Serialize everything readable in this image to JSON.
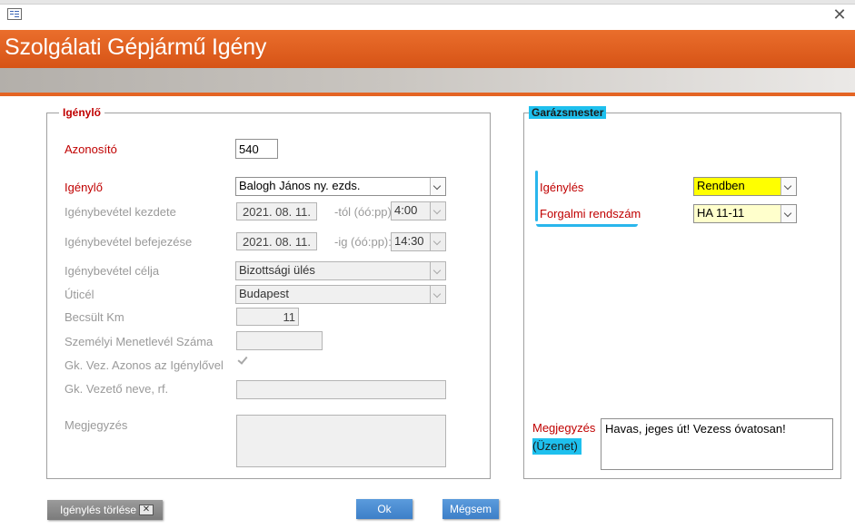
{
  "window": {
    "title": "Szolgálati Gépjármű Igény"
  },
  "igenylo_group": {
    "legend": "Igénylő",
    "azonosito": {
      "label": "Azonosító",
      "value": "540"
    },
    "igenylo": {
      "label": "Igénylő",
      "value": "Balogh János ny. ezds."
    },
    "kezdete": {
      "label": "Igénybevétel kezdete",
      "date": "2021. 08. 11.",
      "time_label": "-tól (óó:pp):",
      "time": "4:00"
    },
    "befejezese": {
      "label": "Igénybevétel befejezése",
      "date": "2021. 08. 11.",
      "time_label": "-ig (óó:pp):",
      "time": "14:30"
    },
    "celja": {
      "label": "Igénybevétel célja",
      "value": "Bizottsági ülés"
    },
    "uticel": {
      "label": "Úticél",
      "value": "Budapest"
    },
    "km": {
      "label": "Becsült Km",
      "value": "11"
    },
    "menetlevel": {
      "label": "Személyi Menetlevél Száma",
      "value": ""
    },
    "gk_azonos": {
      "label": "Gk. Vez. Azonos az Igénylővel",
      "checked": true
    },
    "gk_nev": {
      "label": "Gk. Vezető neve, rf.",
      "value": ""
    },
    "megjegyzes": {
      "label": "Megjegyzés",
      "value": ""
    }
  },
  "garazs_group": {
    "legend": "Garázsmester",
    "igenyles": {
      "label": "Igénylés",
      "value": "Rendben"
    },
    "rendszam": {
      "label": "Forgalmi rendszám",
      "value": "HA 11-11"
    },
    "megjegyzes": {
      "label": "Megjegyzés",
      "label2": "(Üzenet)",
      "value": "Havas, jeges út! Vezess óvatosan!"
    }
  },
  "buttons": {
    "torles": "Igénylés törlése",
    "ok": "Ok",
    "megsem": "Mégsem"
  },
  "colors": {
    "title_bg": "#e0601f",
    "highlight": "#1ec0ee",
    "rendben_bg": "#ffff00",
    "rendszam_bg": "#ffffcc"
  },
  "icons": {
    "form": "form-icon",
    "close": "close-icon",
    "delete": "delete-icon"
  }
}
